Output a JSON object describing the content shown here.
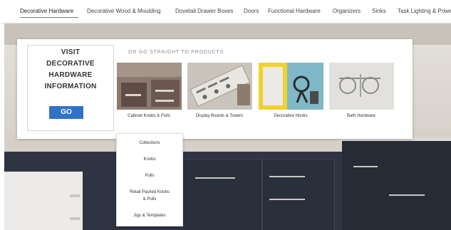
{
  "nav": {
    "items": [
      {
        "label": "Decorative Hardware",
        "active": true
      },
      {
        "label": "Decorative Wood & Moulding"
      },
      {
        "label": "Dovetail Drawer Boxes"
      },
      {
        "label": "Doors"
      },
      {
        "label": "Functional Hardware"
      },
      {
        "label": "Organizers"
      },
      {
        "label": "Sinks"
      },
      {
        "label": "Task Lighting & Power"
      }
    ]
  },
  "mega_menu": {
    "visit_line1": "VISIT",
    "visit_line2": "DECORATIVE",
    "visit_line3": "HARDWARE",
    "visit_line4": "INFORMATION",
    "go_label": "GO",
    "products_heading": "OR GO STRAIGHT TO PRODUCTS",
    "products": [
      {
        "label": "Cabinet Knobs & Pulls"
      },
      {
        "label": "Display Boards & Towers"
      },
      {
        "label": "Decorative Hooks"
      },
      {
        "label": "Bath Hardware"
      }
    ],
    "submenu": {
      "items": [
        {
          "label": "Collections"
        },
        {
          "label": "Knobs"
        },
        {
          "label": "Pulls"
        },
        {
          "label_line1": "Retail Packed Knobs",
          "label_line2": "& Pulls"
        },
        {
          "label": "Jigs & Templates"
        }
      ]
    }
  },
  "colors": {
    "accent_button": "#2f73c9",
    "cabinet_dark": "#2e3442"
  }
}
